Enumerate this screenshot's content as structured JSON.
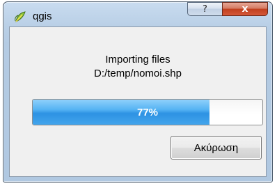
{
  "window": {
    "title": "qgis",
    "app_icon": "qgis-leaf-icon",
    "help_label": "?",
    "close_label": "x"
  },
  "dialog": {
    "message": "Importing files",
    "file_path": "D:/temp/nomoi.shp",
    "progress_text": "77%",
    "progress_value": 0.77,
    "cancel_label": "Ακύρωση"
  },
  "colors": {
    "progress_fill": "#3aa0ea",
    "close_button": "#c94a2c"
  }
}
